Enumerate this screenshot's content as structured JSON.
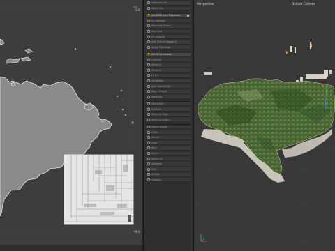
{
  "uv_editor": {
    "corner_top_right": "1.0",
    "corner_bottom_right": "1.0",
    "corner_bottom_left": "0.0"
  },
  "tool_panel": {
    "items": [
      {
        "label": "Optimize UVs",
        "bright": false,
        "icon": "box"
      },
      {
        "label": "Relax UVs",
        "bright": false,
        "icon": "box"
      },
      {
        "label": "Set UVW from Projection",
        "bright": true,
        "icon": "x-icon",
        "dot": true
      },
      {
        "label": "UV Settings",
        "bright": false,
        "icon": "box"
      },
      {
        "label": "Pack and Orient",
        "bright": false,
        "icon": "box"
      },
      {
        "label": "Pack UVs",
        "bright": false,
        "icon": "box"
      },
      {
        "label": "UV Unwrap",
        "bright": false,
        "icon": "box"
      },
      {
        "label": "Add Texture Mapping",
        "bright": false,
        "icon": "box"
      },
      {
        "label": "Apply Projection",
        "bright": false,
        "icon": "box"
      },
      {
        "label": "Fill UV to Canvas",
        "bright": true,
        "icon": "x-icon"
      },
      {
        "label": "Flip UVs",
        "bright": false,
        "icon": "box"
      },
      {
        "label": "Mirror U",
        "bright": false,
        "icon": "box"
      },
      {
        "label": "Mirror V",
        "bright": false,
        "icon": "box"
      },
      {
        "label": "Fit UV",
        "bright": false,
        "icon": "box"
      },
      {
        "label": "Straighten",
        "bright": false,
        "icon": "box"
      },
      {
        "label": "Align Horizontal",
        "bright": false,
        "icon": "box"
      },
      {
        "label": "Align Vertical",
        "bright": false,
        "icon": "box"
      },
      {
        "label": "Weld UVs",
        "bright": false,
        "icon": "box"
      },
      {
        "label": "Stitch UVs",
        "bright": false,
        "icon": "box"
      },
      {
        "label": "Cut UVs",
        "bright": false,
        "icon": "box"
      },
      {
        "label": "Relax by Edge",
        "bright": false,
        "icon": "box"
      },
      {
        "label": "Relax by Angle",
        "bright": false,
        "icon": "box"
      },
      {
        "label": "Select Islands",
        "bright": false,
        "icon": "box"
      },
      {
        "label": "Grow",
        "bright": false,
        "icon": "box"
      },
      {
        "label": "Shrink",
        "bright": false,
        "icon": "box"
      },
      {
        "label": "Loop",
        "bright": false,
        "icon": "box"
      },
      {
        "label": "Ring",
        "bright": false,
        "icon": "box"
      },
      {
        "label": "Invert",
        "bright": false,
        "icon": "box"
      },
      {
        "label": "Select All",
        "bright": false,
        "icon": "box"
      },
      {
        "label": "Deselect",
        "bright": false,
        "icon": "box"
      },
      {
        "label": "Hide",
        "bright": false,
        "icon": "box"
      },
      {
        "label": "Unhide",
        "bright": false,
        "icon": "box"
      },
      {
        "label": "Options",
        "bright": false,
        "icon": "box"
      }
    ]
  },
  "viewport": {
    "title": "Perspective",
    "camera": "Default Camera",
    "colors": {
      "terrain_dark": "#2f4a22",
      "terrain_mid": "#4d6d34",
      "terrain_light": "#7a8f55",
      "terrain_edge": "#d8d4cc",
      "axis_y": "#29b35a",
      "axis_x": "#e54b3a",
      "axis_z": "#3a7ee5",
      "highlight": "#f29a1e"
    }
  },
  "colors": {
    "uv_background": "#3d3d3d",
    "uv_island": "#8a8a8a",
    "uv_island_edge": "#e5e5e5",
    "texture_tile": "#e8e8e8",
    "panel_bg": "#2f2f2f",
    "viewport_bg": "#383838"
  }
}
